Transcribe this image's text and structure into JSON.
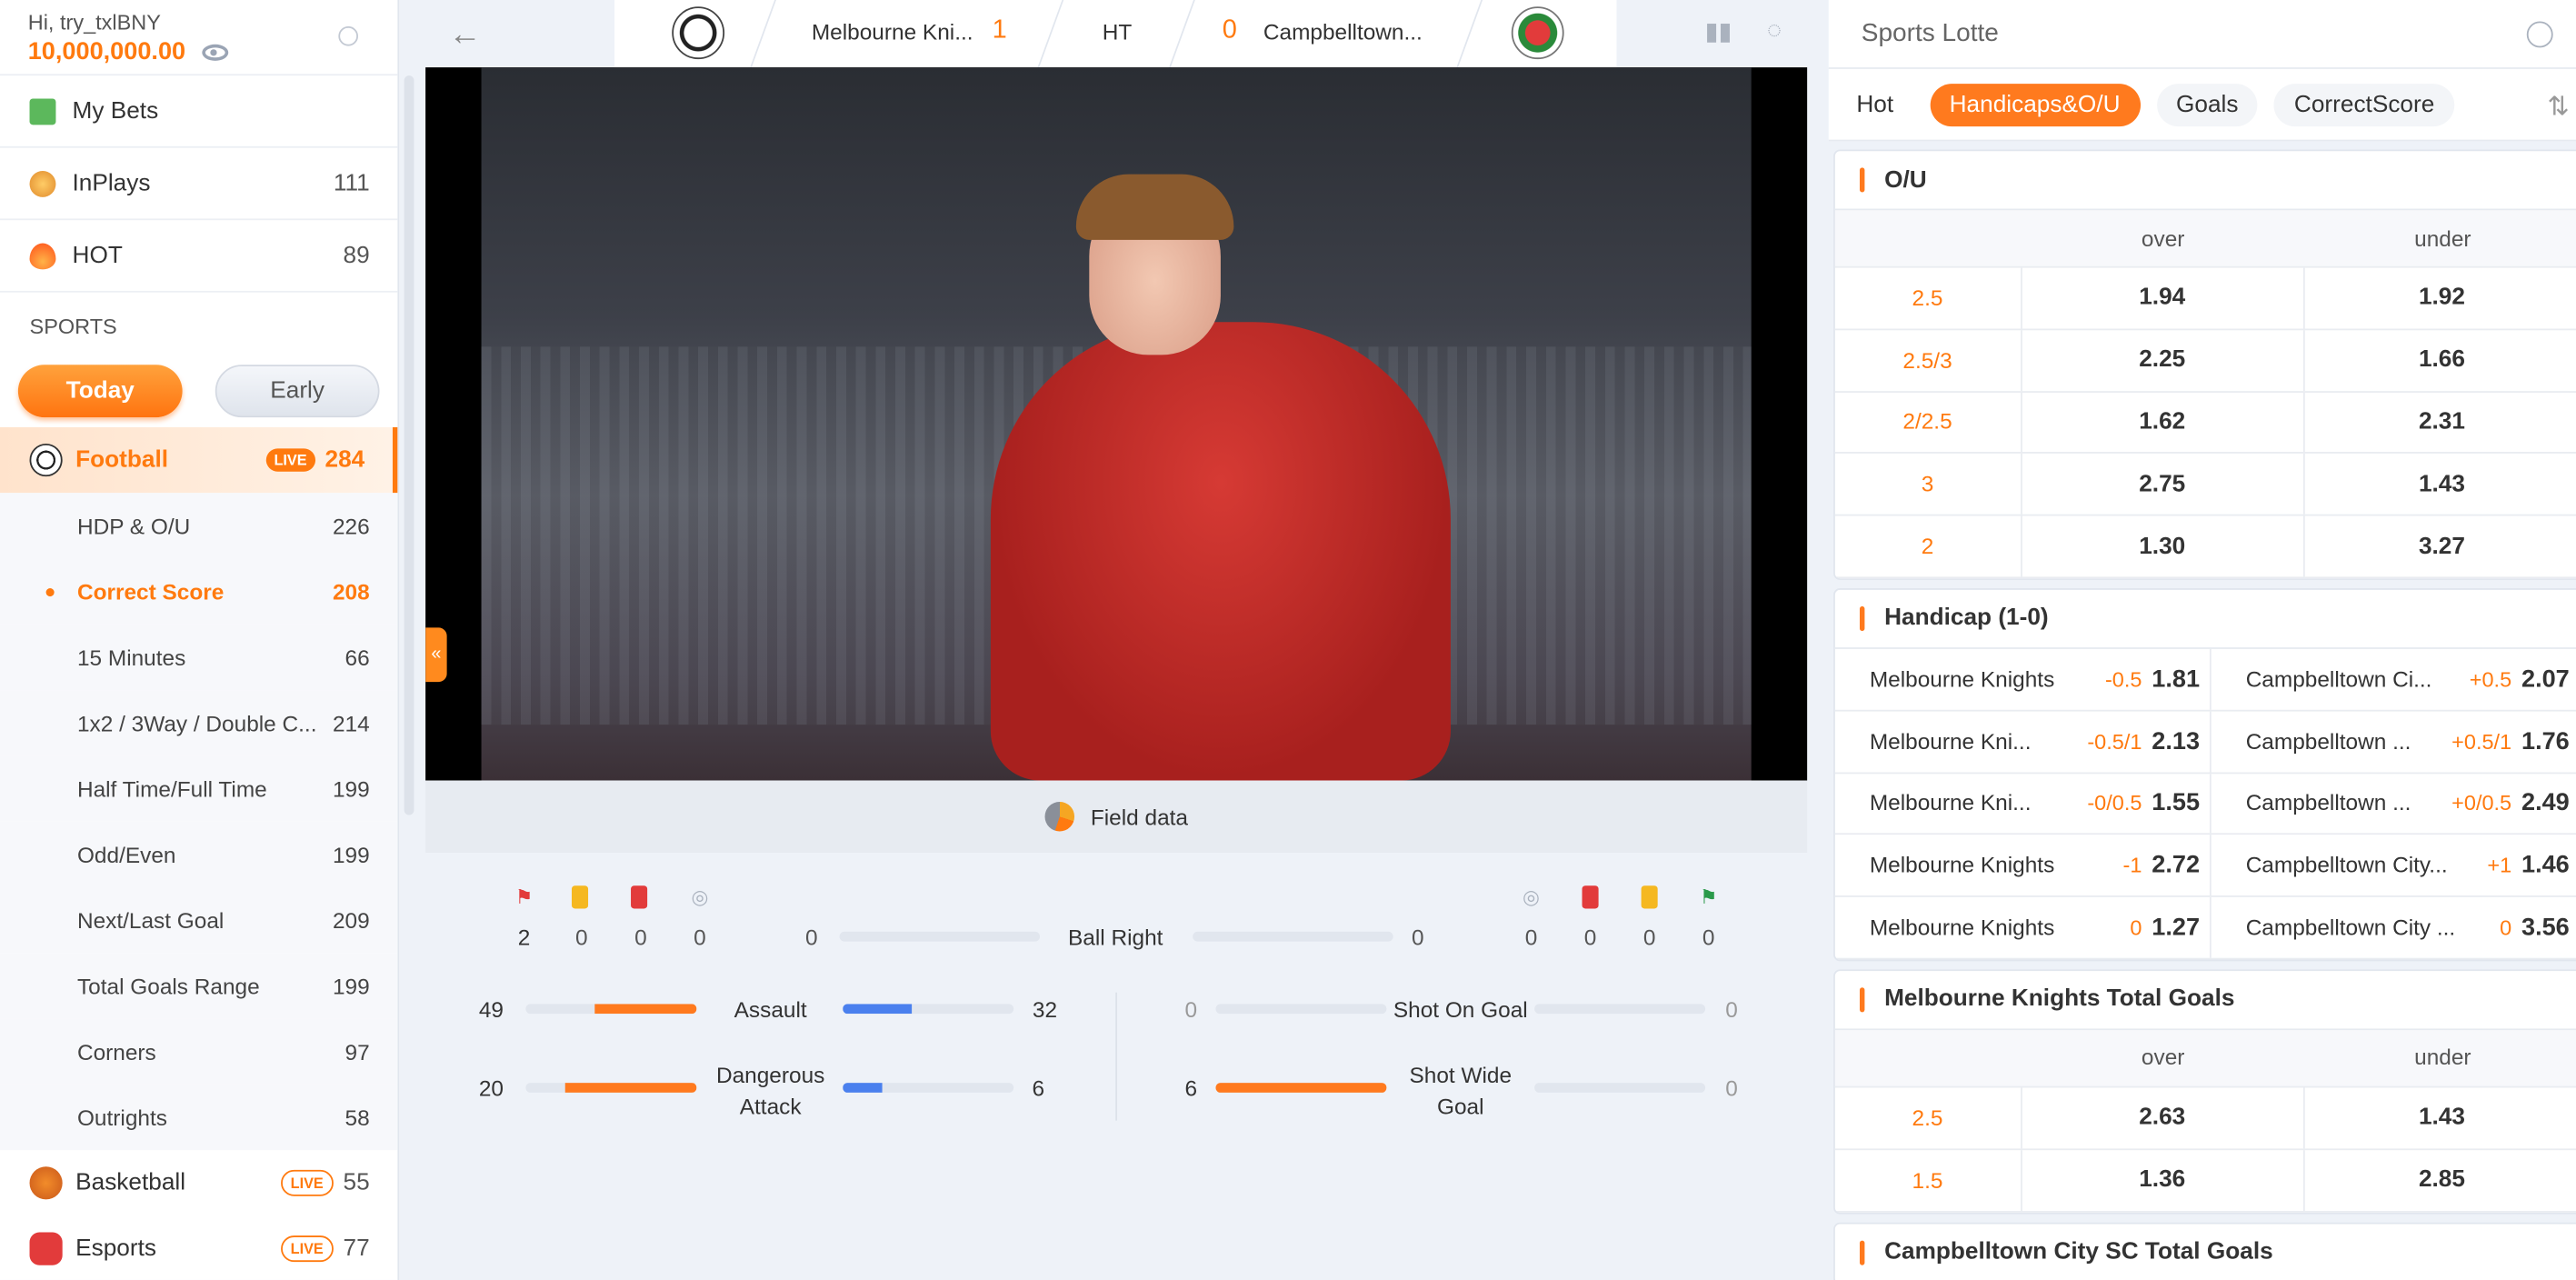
{
  "account": {
    "greeting": "Hi, try_txlBNY",
    "balance": "10,000,000.00"
  },
  "menu": [
    {
      "label": "My Bets",
      "count": ""
    },
    {
      "label": "InPlays",
      "count": "111"
    },
    {
      "label": "HOT",
      "count": "89"
    }
  ],
  "sports_header": "SPORTS",
  "toggle": {
    "today": "Today",
    "early": "Early"
  },
  "football": {
    "label": "Football",
    "live": "LIVE",
    "count": "284"
  },
  "subitems": [
    {
      "label": "HDP & O/U",
      "count": "226"
    },
    {
      "label": "Correct Score",
      "count": "208"
    },
    {
      "label": "15 Minutes",
      "count": "66"
    },
    {
      "label": "1x2 / 3Way / Double C...",
      "count": "214"
    },
    {
      "label": "Half Time/Full Time",
      "count": "199"
    },
    {
      "label": "Odd/Even",
      "count": "199"
    },
    {
      "label": "Next/Last Goal",
      "count": "209"
    },
    {
      "label": "Total Goals Range",
      "count": "199"
    },
    {
      "label": "Corners",
      "count": "97"
    },
    {
      "label": "Outrights",
      "count": "58"
    }
  ],
  "other_sports": [
    {
      "label": "Basketball",
      "live": "LIVE",
      "count": "55"
    },
    {
      "label": "Esports",
      "live": "LIVE",
      "count": "77"
    }
  ],
  "match": {
    "home": "Melbourne Kni...",
    "home_score": "1",
    "status": "HT",
    "away_score": "0",
    "away": "Campbelltown..."
  },
  "field_data_label": "Field data",
  "stats": {
    "home_counts": [
      "2",
      "0",
      "0",
      "0"
    ],
    "away_counts": [
      "0",
      "0",
      "0",
      "0"
    ],
    "ball": {
      "home": "0",
      "label": "Ball Right",
      "away": "0"
    },
    "assault": {
      "home": "49",
      "label": "Assault",
      "away": "32",
      "home_frac": 0.6,
      "away_frac": 0.4
    },
    "dangerous": {
      "home": "20",
      "label1": "Dangerous",
      "label2": "Attack",
      "away": "6",
      "home_frac": 0.77,
      "away_frac": 0.23
    },
    "shot_on": {
      "home": "0",
      "label": "Shot On Goal",
      "away": "0",
      "home_frac": 0,
      "away_frac": 0
    },
    "shot_wide": {
      "home": "6",
      "label1": "Shot Wide",
      "label2": "Goal",
      "away": "0",
      "home_frac": 1.0,
      "away_frac": 0
    }
  },
  "right": {
    "title": "Sports Lotte",
    "tabs": [
      "Hot",
      "Handicaps&O/U",
      "Goals",
      "CorrectScore"
    ],
    "ou": {
      "title": "O/U",
      "over": "over",
      "under": "under",
      "rows": [
        {
          "line": "2.5",
          "over": "1.94",
          "under": "1.92"
        },
        {
          "line": "2.5/3",
          "over": "2.25",
          "under": "1.66"
        },
        {
          "line": "2/2.5",
          "over": "1.62",
          "under": "2.31"
        },
        {
          "line": "3",
          "over": "2.75",
          "under": "1.43"
        },
        {
          "line": "2",
          "over": "1.30",
          "under": "3.27"
        }
      ]
    },
    "handicap": {
      "title": "Handicap (1-0)",
      "rows": [
        {
          "home": "Melbourne Knights",
          "hh": "-0.5",
          "ho": "1.81",
          "away": "Campbelltown Ci...",
          "ah": "+0.5",
          "ao": "2.07"
        },
        {
          "home": "Melbourne Kni...",
          "hh": "-0.5/1",
          "ho": "2.13",
          "away": "Campbelltown ...",
          "ah": "+0.5/1",
          "ao": "1.76"
        },
        {
          "home": "Melbourne Kni...",
          "hh": "-0/0.5",
          "ho": "1.55",
          "away": "Campbelltown ...",
          "ah": "+0/0.5",
          "ao": "2.49"
        },
        {
          "home": "Melbourne Knights",
          "hh": "-1",
          "ho": "2.72",
          "away": "Campbelltown City...",
          "ah": "+1",
          "ao": "1.46"
        },
        {
          "home": "Melbourne Knights",
          "hh": "0",
          "ho": "1.27",
          "away": "Campbelltown City ...",
          "ah": "0",
          "ao": "3.56"
        }
      ]
    },
    "mk_goals": {
      "title": "Melbourne Knights Total Goals",
      "over": "over",
      "under": "under",
      "rows": [
        {
          "line": "2.5",
          "over": "2.63",
          "under": "1.43"
        },
        {
          "line": "1.5",
          "over": "1.36",
          "under": "2.85"
        }
      ]
    },
    "cc_goals": {
      "title": "Campbelltown City SC Total Goals"
    }
  },
  "colors": {
    "accent": "#ff7a0f",
    "blue": "#4a80ee"
  }
}
